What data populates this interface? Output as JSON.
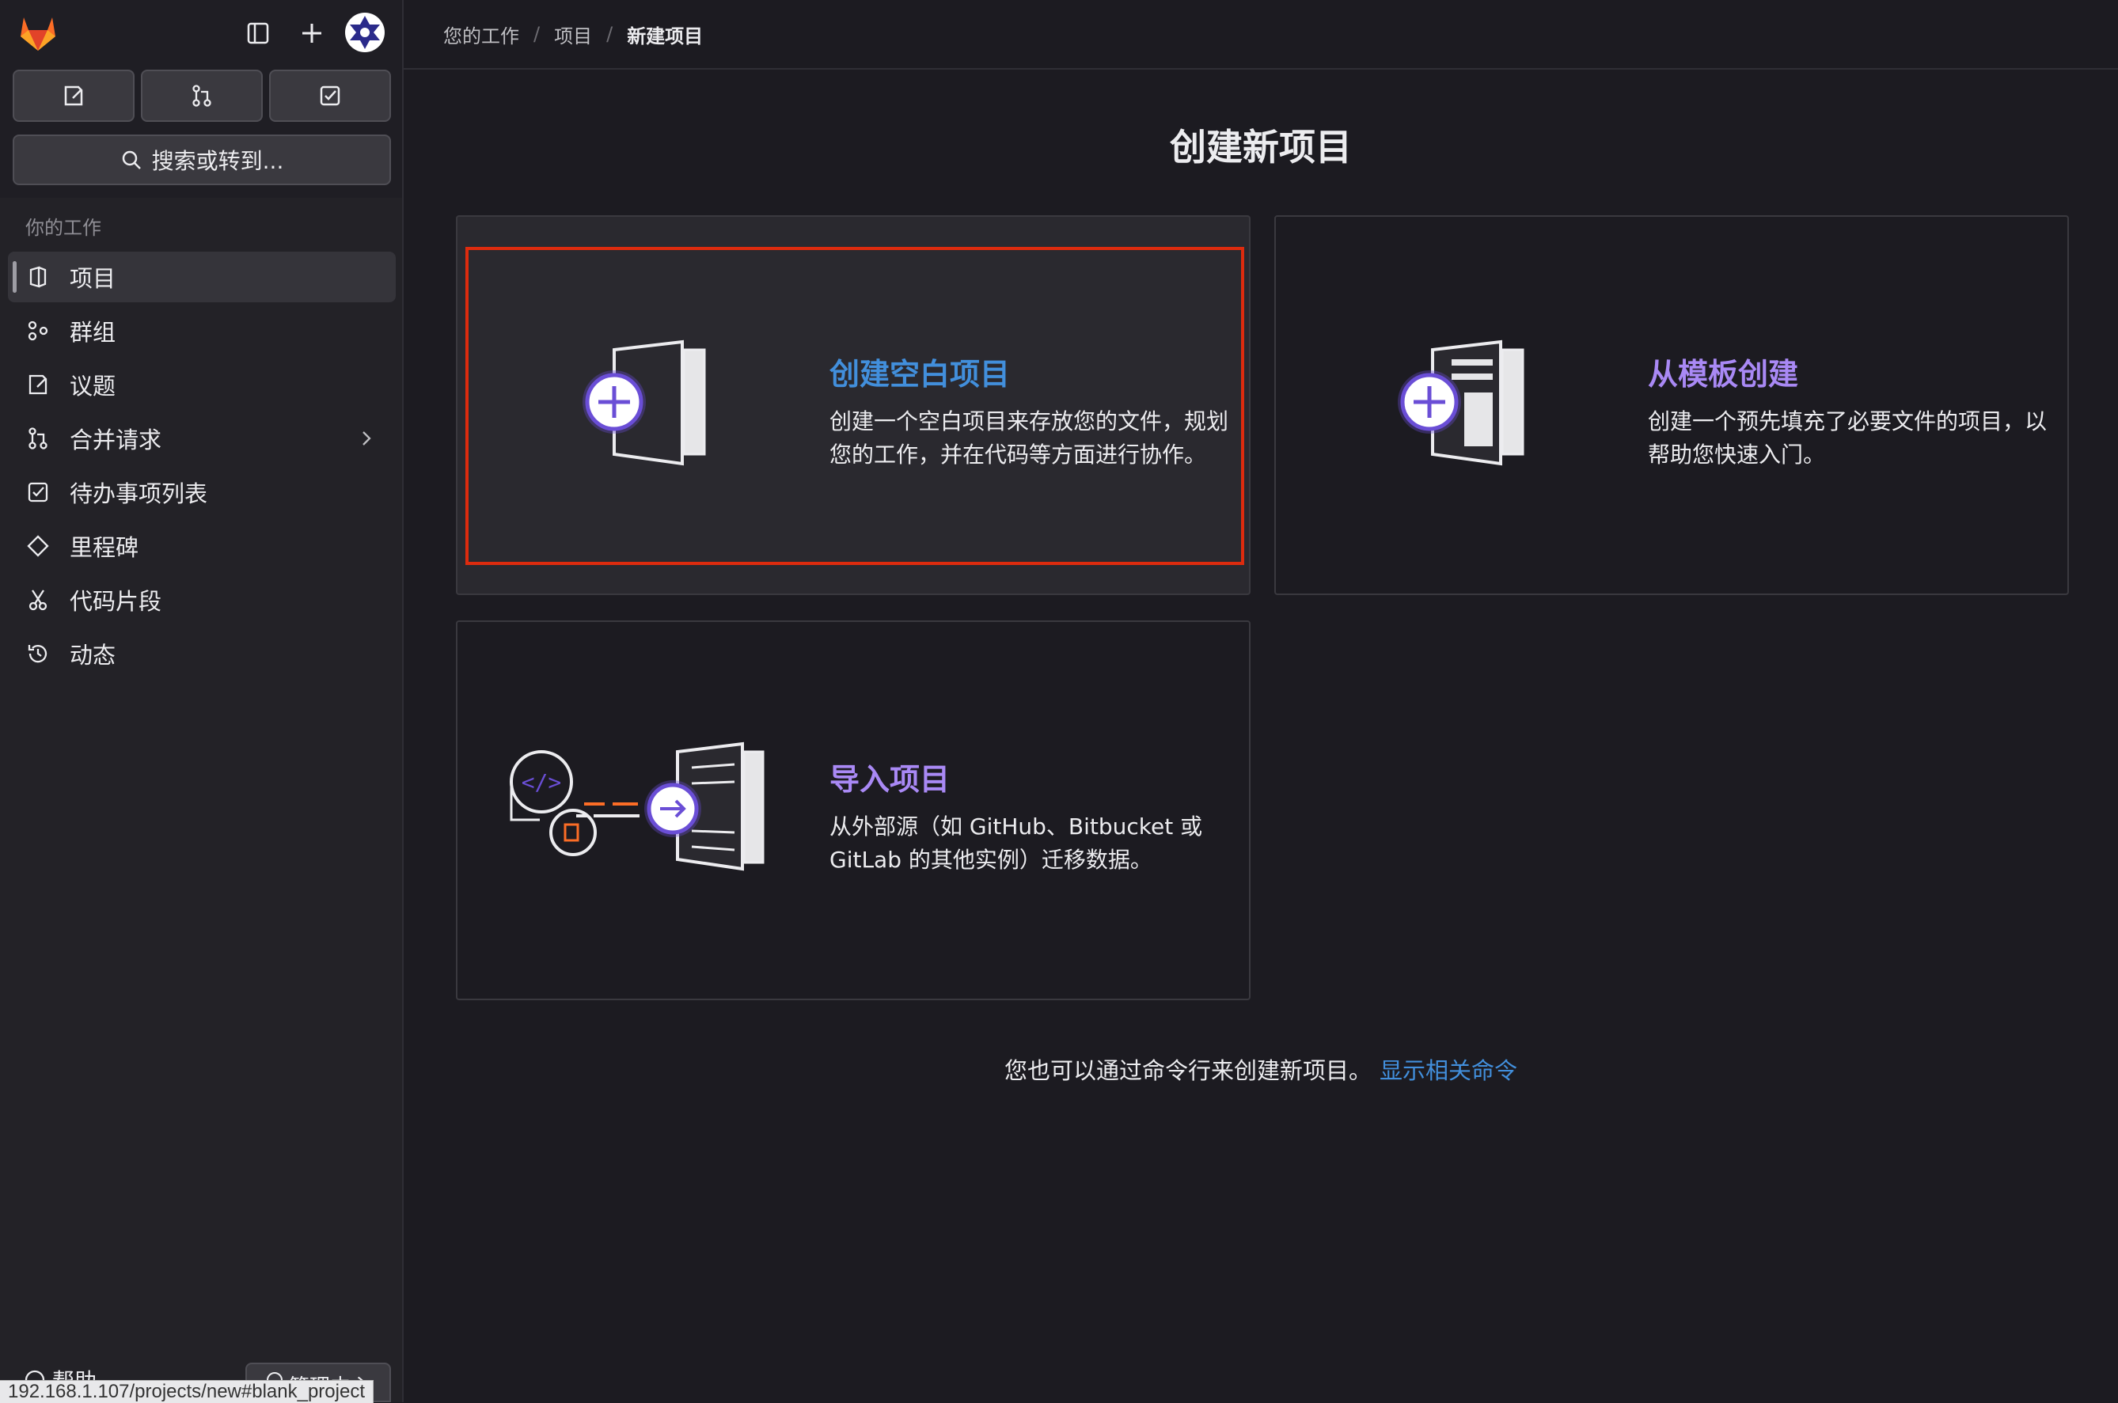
{
  "sidebar": {
    "section_label": "你的工作",
    "items": [
      {
        "label": "项目",
        "icon": "project-icon",
        "active": true
      },
      {
        "label": "群组",
        "icon": "group-icon"
      },
      {
        "label": "议题",
        "icon": "issues-icon"
      },
      {
        "label": "合并请求",
        "icon": "merge-request-icon",
        "has_chevron": true
      },
      {
        "label": "待办事项列表",
        "icon": "todo-icon"
      },
      {
        "label": "里程碑",
        "icon": "milestone-icon"
      },
      {
        "label": "代码片段",
        "icon": "snippet-icon"
      },
      {
        "label": "动态",
        "icon": "activity-icon"
      }
    ],
    "search_label": "搜索或转到...",
    "help_label": "帮助",
    "admin_label": "管理中心"
  },
  "breadcrumb": [
    "您的工作",
    "项目",
    "新建项目"
  ],
  "main": {
    "title": "创建新项目",
    "cards": [
      {
        "title": "创建空白项目",
        "description": "创建一个空白项目来存放您的文件，规划您的工作，并在代码等方面进行协作。",
        "title_color": "#428fdc"
      },
      {
        "title": "从模板创建",
        "description": "创建一个预先填充了必要文件的项目，以帮助您快速入门。",
        "title_color": "#a989f5"
      },
      {
        "title": "导入项目",
        "description": "从外部源（如 GitHub、Bitbucket 或 GitLab 的其他实例）迁移数据。",
        "title_color": "#a989f5"
      }
    ],
    "footer_text": "您也可以通过命令行来创建新项目。",
    "footer_link": "显示相关命令"
  },
  "status_url": "192.168.1.107/projects/new#blank_project",
  "colors": {
    "accent_blue": "#428fdc",
    "accent_purple": "#a989f5",
    "focus_red": "#dd2b0e"
  }
}
